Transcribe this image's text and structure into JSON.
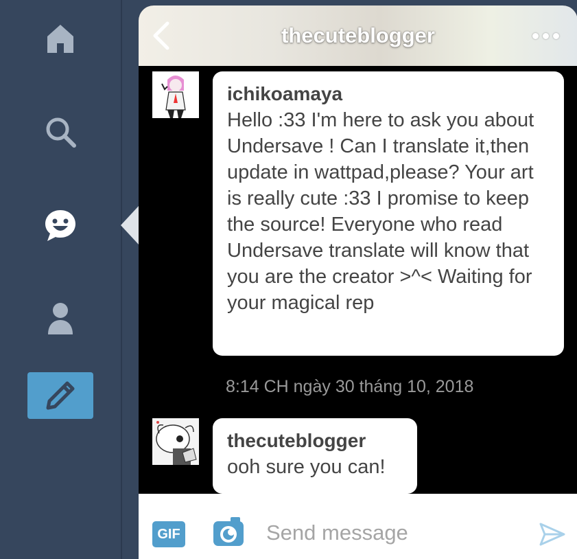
{
  "nav": {
    "items": [
      {
        "icon": "home-icon"
      },
      {
        "icon": "search-icon"
      },
      {
        "icon": "chat-icon",
        "active": true
      },
      {
        "icon": "account-icon"
      },
      {
        "icon": "compose-icon"
      }
    ],
    "colors": {
      "rail": "#36465d",
      "active": "#ffffff",
      "inactive": "#a8b4c3",
      "compose_bg": "#529ecc"
    }
  },
  "chat": {
    "title": "thecuteblogger",
    "messages": [
      {
        "sender": "ichikoamaya",
        "text": "Hello :33 I'm here to ask you about Undersave ! Can I translate it,then update in wattpad,please? Your art is really cute :33 I promise to keep the source! Everyone who read Undersave translate will know that you are the creator >^< Waiting for your magical rep"
      },
      {
        "sender": "thecuteblogger",
        "text": "ooh sure you can!"
      }
    ],
    "timestamp": "8:14 CH ngày 30 tháng 10, 2018"
  },
  "composer": {
    "gif_label": "GIF",
    "placeholder": "Send message",
    "value": ""
  }
}
